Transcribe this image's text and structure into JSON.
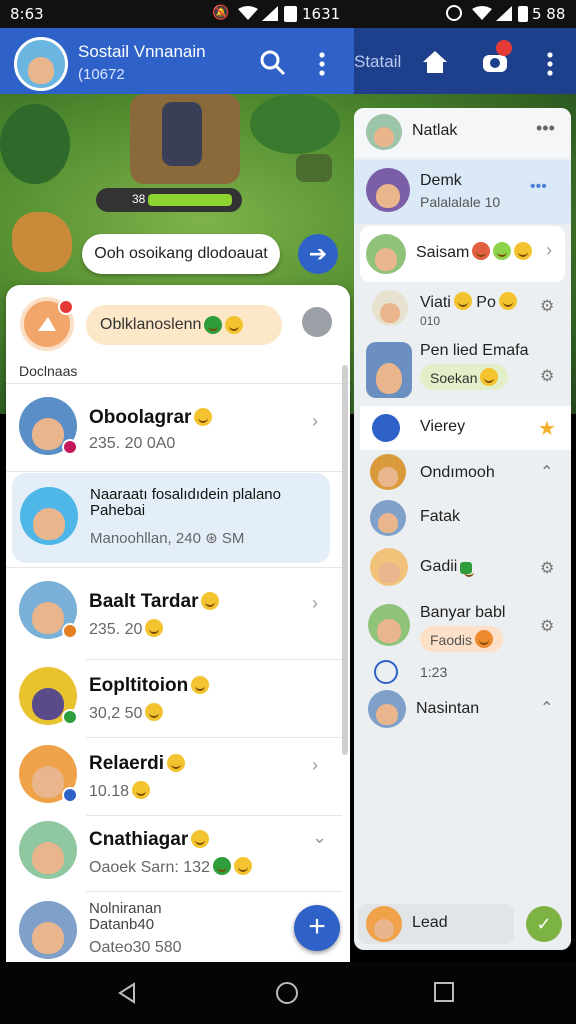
{
  "status_bar": {
    "time": "8:63",
    "right_text": "1631",
    "right_text_2": "1631",
    "battery": "5 88"
  },
  "header": {
    "title": "Sostail Vnnanain",
    "subtitle": "(10672",
    "right_title": "Statail"
  },
  "game": {
    "speech_text": "Ooh osoikang dlodoauat",
    "bar_label": "38"
  },
  "panel": {
    "status_chip": "Oblklanoslenn",
    "section_label": "Doclnaas",
    "chats": [
      {
        "name": "Oboolagrar",
        "sub": "235. 20 0A0"
      },
      {
        "name": "Naaraatı fosalıdıdein plalano Pahebai",
        "sub": "Manoohllan, 240 ⊛ SM"
      },
      {
        "name": "Baalt Tardar",
        "sub": "235. 20"
      },
      {
        "name": "Eopltitoion",
        "sub": "30,2 50"
      },
      {
        "name": "Relaerdi",
        "sub": "10.18"
      },
      {
        "name": "Cnathiagar",
        "sub": "Oaoek Sarn: 132"
      },
      {
        "name": "Nolniranan Datanb40",
        "sub": "Oateo30 580"
      }
    ]
  },
  "right_panel": {
    "items": [
      {
        "name": "Natlak",
        "sub": ""
      },
      {
        "name": "Demk",
        "sub": "Palalalale 10"
      },
      {
        "name": "Saisam",
        "sub": ""
      },
      {
        "name": "Viati",
        "sub": "010",
        "extra": "Po"
      },
      {
        "name": "Pen lied Emafa",
        "sub": "",
        "chip": "Soekan"
      },
      {
        "name": "Vierey",
        "sub": ""
      },
      {
        "name": "Ondımooh",
        "sub": ""
      },
      {
        "name": "Fatak",
        "sub": ""
      },
      {
        "name": "Gadii",
        "sub": ""
      },
      {
        "name": "Banyar babl",
        "sub": "",
        "chip": "Faodis"
      },
      {
        "name": "1:23",
        "sub": ""
      },
      {
        "name": "Nasintan",
        "sub": ""
      }
    ],
    "footer_input": "Lead"
  },
  "colors": {
    "primary": "#2f62c9",
    "dark_bar": "#1e3f8c",
    "fab": "#2f62c9",
    "accent_green": "#2e9d3c"
  }
}
